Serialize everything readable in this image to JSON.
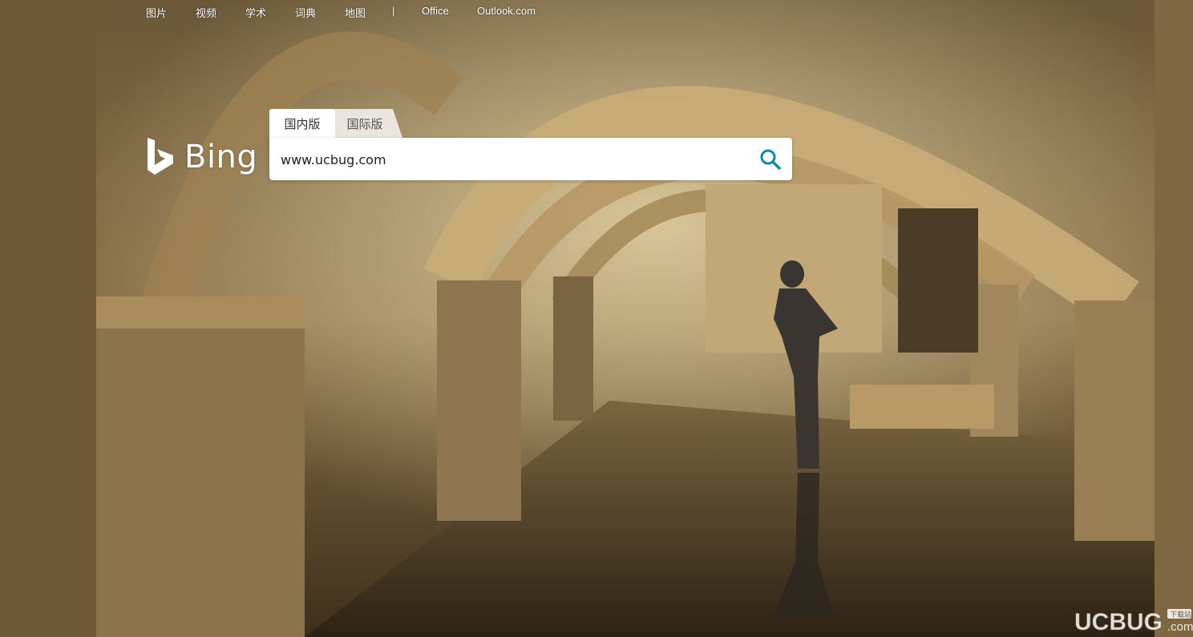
{
  "nav": {
    "items": [
      "图片",
      "视频",
      "学术",
      "词典",
      "地图",
      "|",
      "Office",
      "Outlook.com"
    ]
  },
  "logo": {
    "text": "Bing"
  },
  "tabs": [
    {
      "label": "国内版",
      "active": true
    },
    {
      "label": "国际版",
      "active": false
    }
  ],
  "search": {
    "value": "www.ucbug.com"
  },
  "watermark": {
    "text": "UCBUG",
    "sub": "下载站",
    "suffix": ".com"
  },
  "colors": {
    "search_icon": "#0c8aa8",
    "nav_text": "#ffffff"
  }
}
